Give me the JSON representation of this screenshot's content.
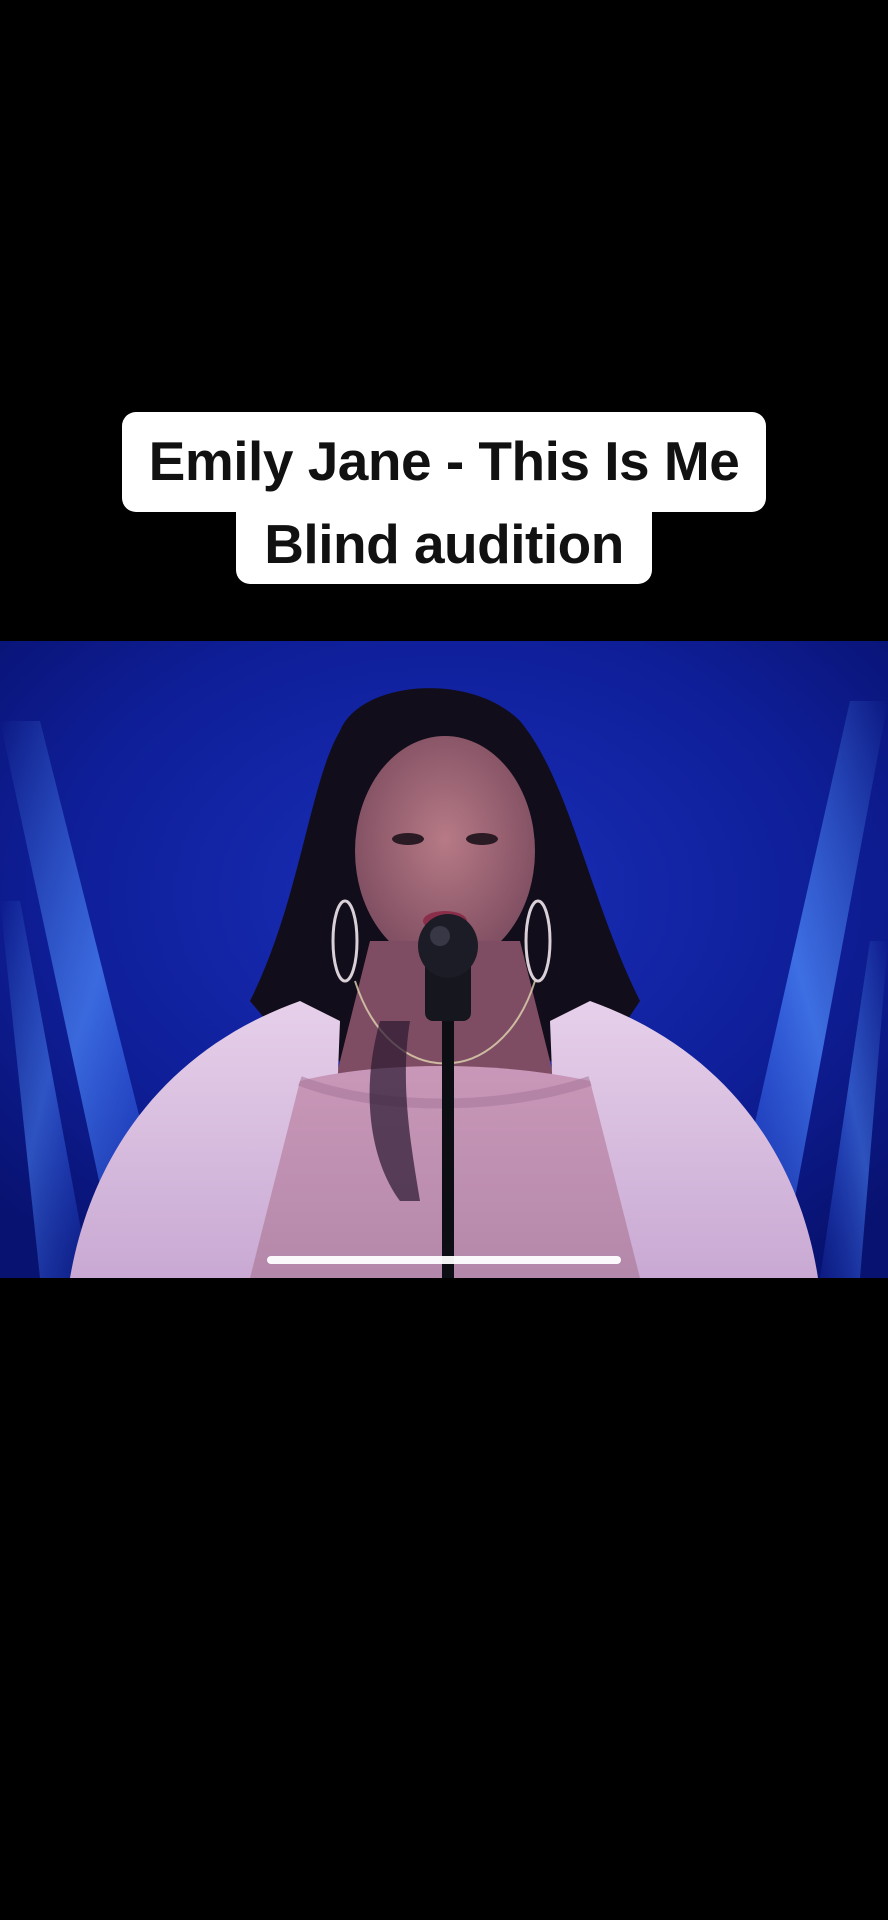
{
  "caption": {
    "line1": "Emily Jane - This Is Me",
    "line2": "Blind audition"
  },
  "video": {
    "description_icon": "video-frame",
    "stage_color": "#1a2fd6",
    "light_color": "#3a7bff"
  },
  "playback": {
    "progress": 1.0
  },
  "colors": {
    "background": "#000000",
    "caption_bg": "#ffffff",
    "caption_text": "#111111"
  }
}
